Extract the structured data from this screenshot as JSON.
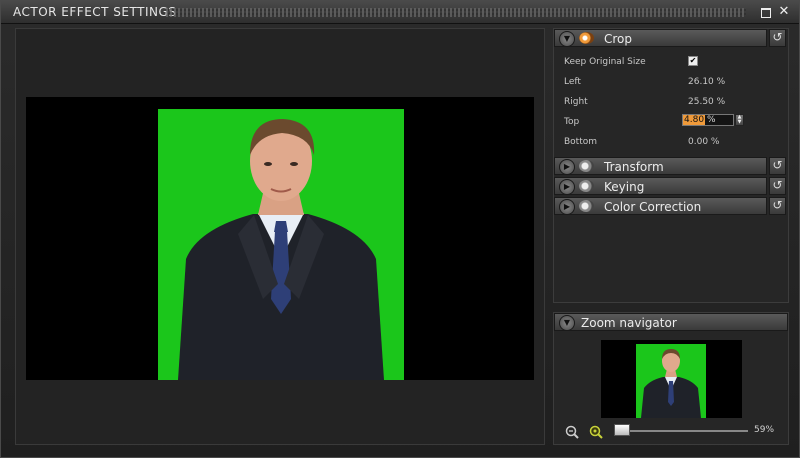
{
  "window": {
    "title": "ACTOR EFFECT SETTINGS",
    "maximize_icon": "maximize-icon",
    "close_glyph": "✕"
  },
  "sections": {
    "crop": {
      "label": "Crop",
      "expanded": true,
      "properties": {
        "keep_original_size_label": "Keep Original Size",
        "keep_original_size_checked": true,
        "left_label": "Left",
        "left_value": "26.10 %",
        "right_label": "Right",
        "right_value": "25.50 %",
        "top_label": "Top",
        "top_value": "4.80",
        "top_unit": "%",
        "bottom_label": "Bottom",
        "bottom_value": "0.00 %"
      }
    },
    "transform": {
      "label": "Transform"
    },
    "keying": {
      "label": "Keying"
    },
    "color_correction": {
      "label": "Color Correction"
    }
  },
  "zoom_navigator": {
    "label": "Zoom navigator",
    "zoom_percent": "59%"
  },
  "colors": {
    "accent": "#f09a3a",
    "greenscreen": "#1bc61b"
  }
}
